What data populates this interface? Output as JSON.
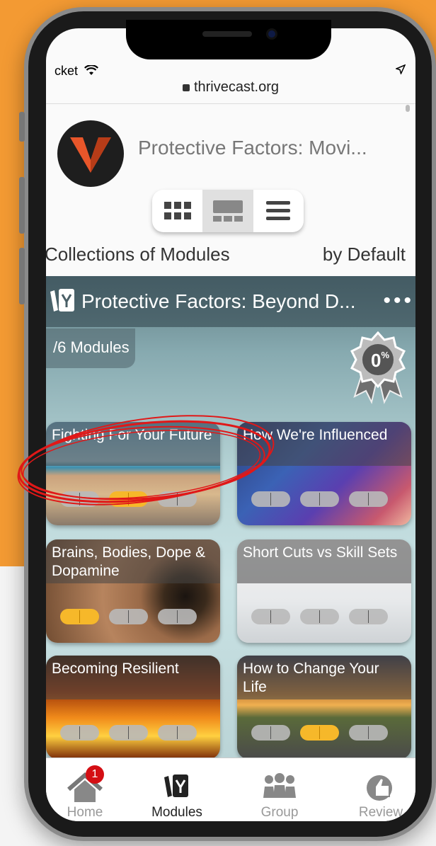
{
  "status_bar": {
    "carrier": "cket",
    "wifi_icon": "wifi-icon",
    "location_icon": "location-arrow-icon"
  },
  "browser": {
    "url": "thrivecast.org"
  },
  "header": {
    "title": "Protective Factors: Movi..."
  },
  "view_toggle": {
    "options": [
      "grid-small-icon",
      "grid-large-icon",
      "list-icon"
    ],
    "selected": 1
  },
  "collections": {
    "label": "Collections of Modules",
    "sort": "by Default"
  },
  "collection": {
    "title": "Protective Factors: Beyond D...",
    "module_count": "/6 Modules",
    "progress": {
      "percent": "0",
      "unit": "%"
    }
  },
  "modules": [
    {
      "title": "Fighting For Your Future",
      "progress": [
        false,
        true,
        false
      ]
    },
    {
      "title": "How We're Influenced",
      "progress": [
        false,
        false,
        false
      ]
    },
    {
      "title": "Brains, Bodies, Dope & Dopamine",
      "progress": [
        true,
        false,
        false
      ]
    },
    {
      "title": "Short Cuts vs Skill Sets",
      "progress": [
        false,
        false,
        false
      ]
    },
    {
      "title": "Becoming Resilient",
      "progress": [
        false,
        false,
        false
      ]
    },
    {
      "title": "How to Change Your Life",
      "progress": [
        false,
        true,
        false
      ]
    }
  ],
  "nav": [
    {
      "label": "Home",
      "badge": "1",
      "icon": "home-icon"
    },
    {
      "label": "Modules",
      "icon": "modules-icon",
      "active": true
    },
    {
      "label": "Group",
      "icon": "group-icon"
    },
    {
      "label": "Review",
      "icon": "thumbs-up-icon"
    }
  ],
  "colors": {
    "accent": "#f39a33",
    "progress_done": "#f6b82a",
    "badge": "#d40f14",
    "annotation": "#e01818"
  }
}
